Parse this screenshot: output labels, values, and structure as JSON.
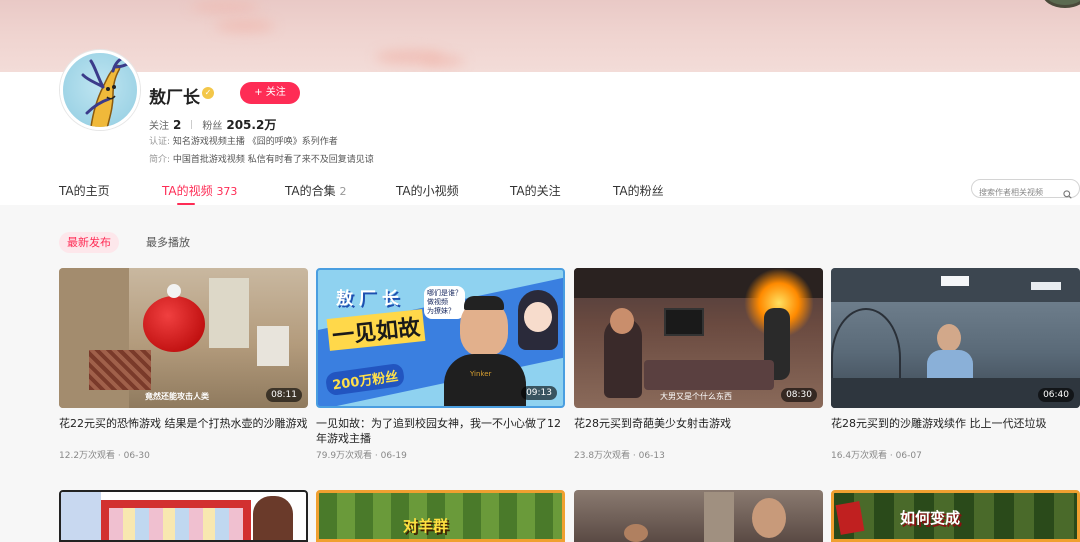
{
  "profile": {
    "name": "敖厂长",
    "follow_label": "+ 关注",
    "following_label": "关注",
    "following_count": "2",
    "fans_label": "粉丝",
    "fans_count": "205.2万",
    "cert_label": "认证:",
    "cert_text": "知名游戏视频主播 《囧的呼唤》系列作者",
    "intro_label": "简介:",
    "intro_text": "中国首批游戏视频 私信有时看了来不及回复请见谅"
  },
  "tabs": [
    {
      "label": "TA的主页",
      "count": ""
    },
    {
      "label": "TA的视频",
      "count": "373"
    },
    {
      "label": "TA的合集",
      "count": "2"
    },
    {
      "label": "TA的小视频",
      "count": ""
    },
    {
      "label": "TA的关注",
      "count": ""
    },
    {
      "label": "TA的粉丝",
      "count": ""
    }
  ],
  "search": {
    "placeholder": "搜索作者相关视频"
  },
  "filters": {
    "latest": "最新发布",
    "most_played": "最多播放"
  },
  "videos": [
    {
      "duration": "08:11",
      "caption": "竟然还能攻击人类",
      "title": "花22元买的恐怖游戏 结果是个打热水壶的沙雕游戏",
      "views": "12.2万次观看",
      "date": "06-30"
    },
    {
      "duration": "09:13",
      "caption": "",
      "title": "一见如故：为了追到校园女神，我一不小心做了12年游戏主播",
      "views": "79.9万次观看",
      "date": "06-19"
    },
    {
      "duration": "08:30",
      "caption": "大男又是个什么东西",
      "title": "花28元买到奇葩美少女射击游戏",
      "views": "23.8万次观看",
      "date": "06-13"
    },
    {
      "duration": "06:40",
      "caption": "",
      "title": "花28元买到的沙雕游戏续作 比上一代还垃圾",
      "views": "16.4万次观看",
      "date": "06-07"
    }
  ],
  "thumb_text": {
    "v2_line1": "敖 厂 长",
    "v2_line2": "一见如故",
    "v2_badge": "200万粉丝",
    "v2_bubble": "哪们是谁？\n做视频\n为撩妹？",
    "v2_shirt": "Yinker",
    "r2_b": "对羊群",
    "r2_d": "如何变成"
  },
  "colors": {
    "accent": "#fe2c55",
    "tab_active": "#fe2c55"
  },
  "separator": " · "
}
